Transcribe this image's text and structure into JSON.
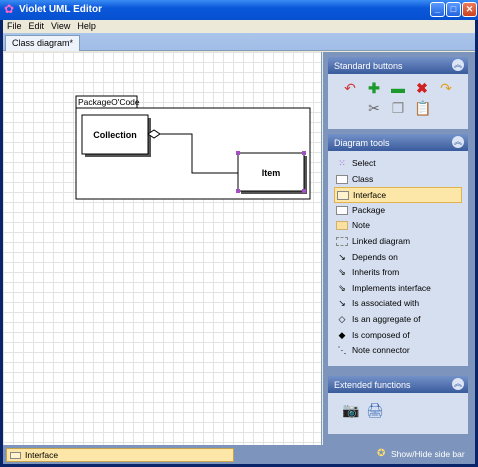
{
  "window": {
    "title": "Violet UML Editor"
  },
  "menu": [
    "File",
    "Edit",
    "View",
    "Help"
  ],
  "tab": {
    "label": "Class diagram*"
  },
  "diagram": {
    "package_label": "PackageO'Code",
    "classes": [
      "Collection",
      "Item"
    ]
  },
  "panels": {
    "standard": {
      "title": "Standard buttons",
      "icons": [
        "undo-icon",
        "add-icon",
        "remove-icon",
        "delete-icon",
        "redo-icon",
        "cut-icon",
        "copy-icon",
        "paste-icon"
      ]
    },
    "tools": {
      "title": "Diagram tools",
      "items": [
        "Select",
        "Class",
        "Interface",
        "Package",
        "Note",
        "Linked diagram",
        "Depends on",
        "Inherits from",
        "Implements interface",
        "Is associated with",
        "Is an aggregate of",
        "Is composed of",
        "Note connector"
      ],
      "selected": "Interface"
    },
    "extended": {
      "title": "Extended functions",
      "icons": [
        "screenshot-icon",
        "print-icon"
      ]
    }
  },
  "status": {
    "current_tool": "Interface",
    "toggle_label": "Show/Hide side bar"
  },
  "colors": {
    "title_bar": "#0a57d9",
    "sidebar": "#7d95bd",
    "selected_tool": "#fce7a9"
  }
}
